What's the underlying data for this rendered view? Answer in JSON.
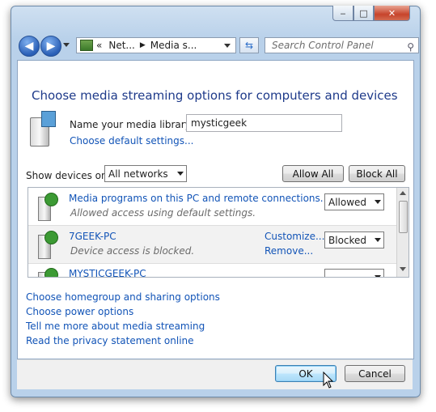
{
  "window": {
    "minimize": "‒",
    "maximize": "□",
    "close": "✕"
  },
  "address": {
    "chevron": "«",
    "crumbs": [
      "Net...",
      "Media s..."
    ],
    "search_placeholder": "Search Control Panel"
  },
  "main": {
    "title": "Choose media streaming options for computers and devices",
    "library_label": "Name your media library:",
    "library_value": "mysticgeek",
    "default_settings_link": "Choose default settings...",
    "show_devices_label": "Show devices on:",
    "show_devices_value": "All networks",
    "allow_all": "Allow All",
    "block_all": "Block All"
  },
  "devices": [
    {
      "name": "Media programs on this PC and remote connections...",
      "status": "Allowed access using default settings.",
      "access": "Allowed",
      "customize": "",
      "remove": ""
    },
    {
      "name": "7GEEK-PC",
      "status": "Device access is blocked.",
      "access": "Blocked",
      "customize": "Customize...",
      "remove": "Remove..."
    },
    {
      "name": "MYSTICGEEK-PC",
      "status": "",
      "access": "",
      "customize": "",
      "remove": ""
    }
  ],
  "links": [
    "Choose homegroup and sharing options",
    "Choose power options",
    "Tell me more about media streaming",
    "Read the privacy statement online"
  ],
  "footer": {
    "ok": "OK",
    "cancel": "Cancel"
  },
  "colors": {
    "link": "#1254b7",
    "heading": "#1e3a8a",
    "frame": "#b9d1ea"
  }
}
